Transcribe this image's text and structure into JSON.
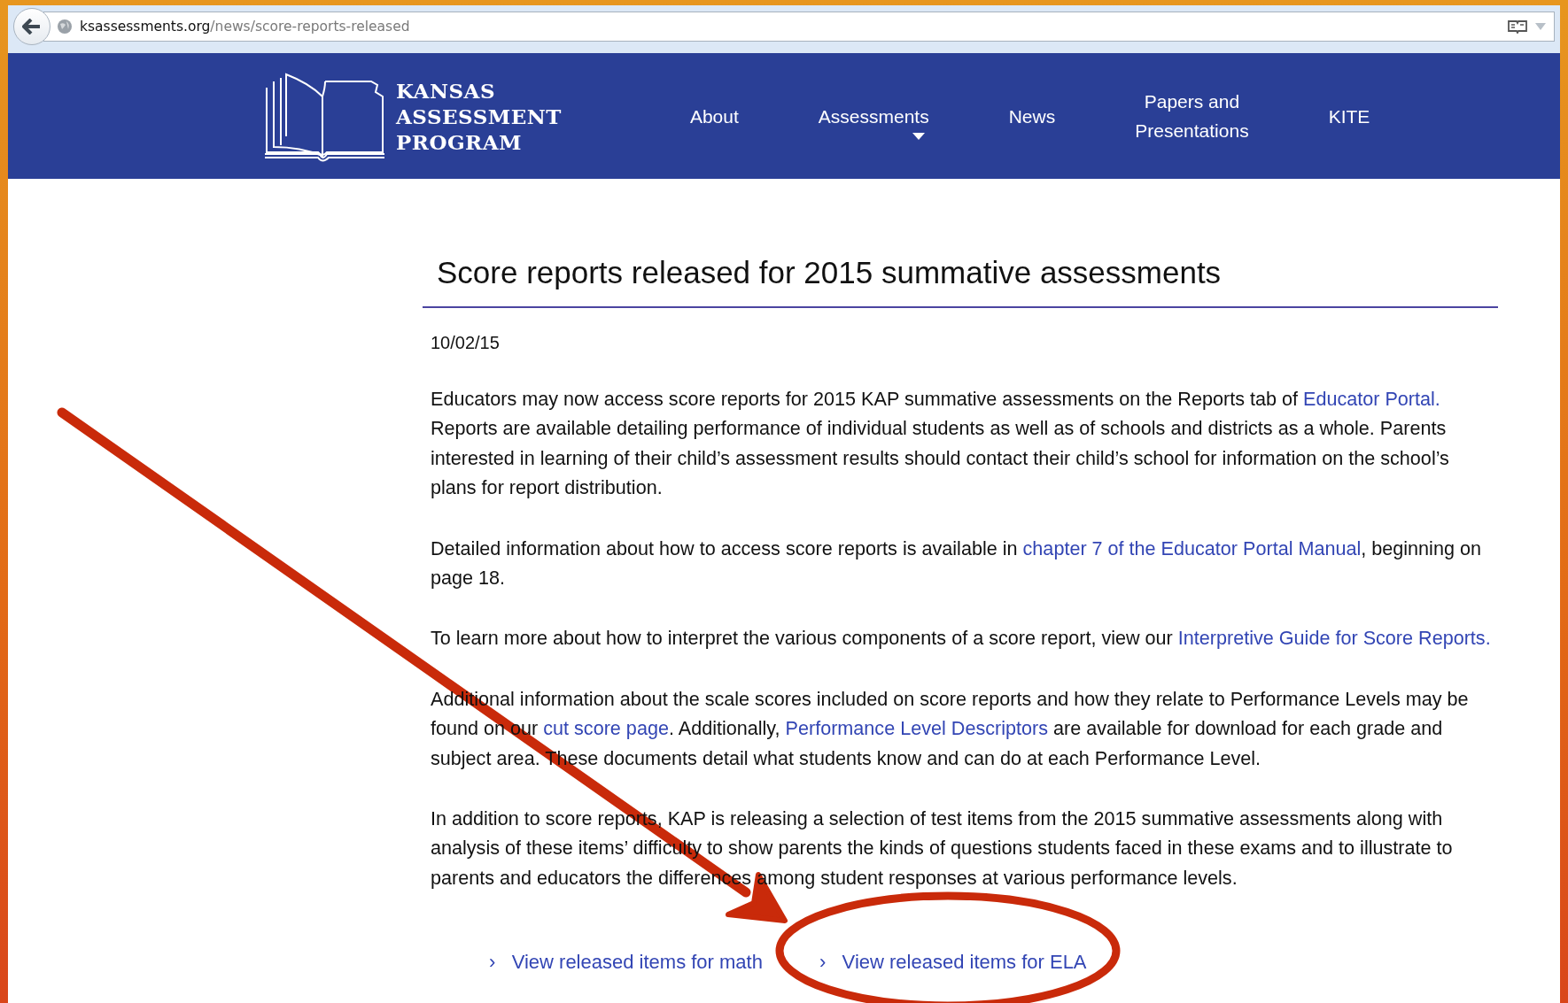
{
  "browser": {
    "url_domain": "ksassessments.org",
    "url_path": "/news/score-reports-released"
  },
  "header": {
    "logo_lines": [
      "KANSAS",
      "ASSESSMENT",
      "PROGRAM"
    ],
    "nav": [
      {
        "lines": [
          "About"
        ],
        "has_dropdown": false
      },
      {
        "lines": [
          "Assessments"
        ],
        "has_dropdown": true
      },
      {
        "lines": [
          "News"
        ],
        "has_dropdown": false
      },
      {
        "lines": [
          "Papers and",
          "Presentations"
        ],
        "has_dropdown": false
      },
      {
        "lines": [
          "KITE"
        ],
        "has_dropdown": false
      }
    ]
  },
  "article": {
    "title": "Score reports released for 2015 summative assessments",
    "date": "10/02/15",
    "paragraphs": [
      [
        {
          "kind": "text",
          "text": "Educators may now access score reports for 2015 KAP summative assessments on the Reports tab of "
        },
        {
          "kind": "link",
          "text": "Educator Portal."
        },
        {
          "kind": "text",
          "text": " Reports are available detailing performance of individual students as well as of schools and districts as a whole. Parents interested in learning of their child’s assessment results should contact their child’s school for information on the school’s plans for report distribution."
        }
      ],
      [
        {
          "kind": "text",
          "text": "Detailed information about how to access score reports is available in "
        },
        {
          "kind": "link",
          "text": "chapter 7 of the Educator Portal Manual"
        },
        {
          "kind": "text",
          "text": ", beginning on page 18."
        }
      ],
      [
        {
          "kind": "text",
          "text": "To learn more about how to interpret the various components of a score report, view our "
        },
        {
          "kind": "link",
          "text": "Interpretive Guide for Score Reports."
        }
      ],
      [
        {
          "kind": "text",
          "text": "Additional information about the scale scores included on score reports and how they relate to Performance Levels may be found on our "
        },
        {
          "kind": "link",
          "text": "cut score page"
        },
        {
          "kind": "text",
          "text": ". Additionally, "
        },
        {
          "kind": "link",
          "text": "Performance Level Descriptors"
        },
        {
          "kind": "text",
          "text": " are available for download for each grade and subject area.  These documents detail what students know and can do at each Performance Level."
        }
      ],
      [
        {
          "kind": "text",
          "text": "In addition to score reports, KAP is releasing a selection of test items from the 2015 summative assessments along with analysis of these items’ difficulty to show parents the kinds of questions students faced in these exams and to illustrate to parents and educators the differences among student responses at various performance levels."
        }
      ]
    ],
    "links": [
      {
        "marker": "›",
        "label": "View released items for math"
      },
      {
        "marker": "›",
        "label": "View released items for ELA"
      }
    ]
  }
}
